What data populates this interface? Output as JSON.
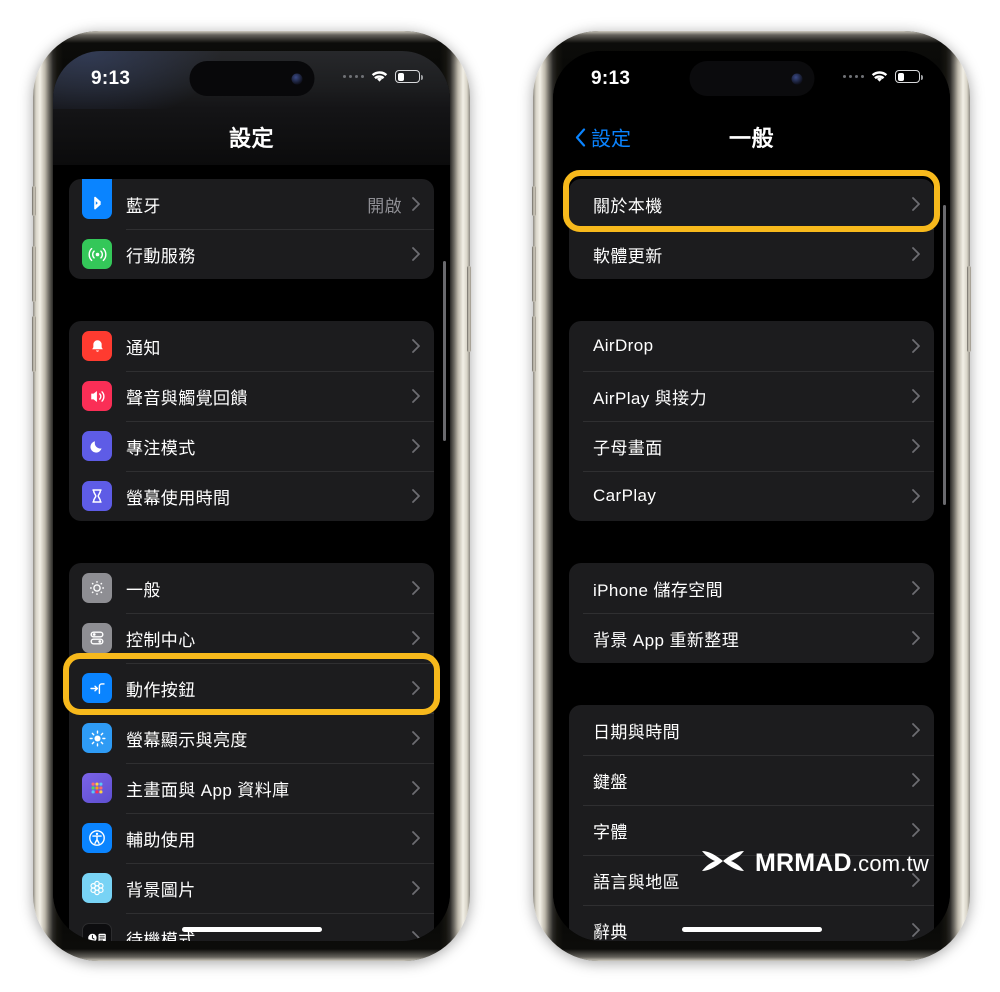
{
  "meta": {
    "highlight_color": "#f7b91c",
    "accent_blue": "#0a84ff",
    "row_bg": "#1c1c1e",
    "screen_bg": "#000000"
  },
  "watermark": {
    "name": "MRMAD",
    "suffix": ".com.tw",
    "logo_icon": "mrmad-bowtie-logo"
  },
  "left_phone": {
    "status_bar": {
      "time": "9:13",
      "cellular_icon": "cellular-dots-icon",
      "wifi_icon": "wifi-icon",
      "battery_icon": "battery-low-icon"
    },
    "nav": {
      "title": "設定"
    },
    "peek_row": {
      "icon": "wifi-app-icon"
    },
    "groups": [
      {
        "rows": [
          {
            "label": "藍牙",
            "value": "開啟",
            "icon": "bluetooth-icon",
            "icon_color": "#0a84ff",
            "chevron": "chevron-right-icon"
          },
          {
            "label": "行動服務",
            "value": "",
            "icon": "cellular-app-icon",
            "icon_color": "#34c759",
            "chevron": "chevron-right-icon"
          }
        ]
      },
      {
        "rows": [
          {
            "label": "通知",
            "value": "",
            "icon": "notifications-icon",
            "icon_color": "#ff3b30",
            "chevron": "chevron-right-icon"
          },
          {
            "label": "聲音與觸覺回饋",
            "value": "",
            "icon": "sounds-haptics-icon",
            "icon_color": "#fa2e56",
            "chevron": "chevron-right-icon"
          },
          {
            "label": "專注模式",
            "value": "",
            "icon": "focus-moon-icon",
            "icon_color": "#5e5ce6",
            "chevron": "chevron-right-icon"
          },
          {
            "label": "螢幕使用時間",
            "value": "",
            "icon": "screen-time-hourglass-icon",
            "icon_color": "#5e5ce6",
            "chevron": "chevron-right-icon"
          }
        ]
      },
      {
        "rows": [
          {
            "label": "一般",
            "value": "",
            "icon": "general-gear-icon",
            "icon_color": "#8e8e93",
            "chevron": "chevron-right-icon",
            "highlighted": true
          },
          {
            "label": "控制中心",
            "value": "",
            "icon": "control-center-icon",
            "icon_color": "#8e8e93",
            "chevron": "chevron-right-icon"
          },
          {
            "label": "動作按鈕",
            "value": "",
            "icon": "action-button-icon",
            "icon_color": "#0a84ff",
            "chevron": "chevron-right-icon"
          },
          {
            "label": "螢幕顯示與亮度",
            "value": "",
            "icon": "display-brightness-icon",
            "icon_color": "#0a84ff",
            "chevron": "chevron-right-icon"
          },
          {
            "label": "主畫面與 App 資料庫",
            "value": "",
            "icon": "home-screen-app-library-icon",
            "icon_color": "#6b5bd6",
            "chevron": "chevron-right-icon"
          },
          {
            "label": "輔助使用",
            "value": "",
            "icon": "accessibility-icon",
            "icon_color": "#0a84ff",
            "chevron": "chevron-right-icon"
          },
          {
            "label": "背景圖片",
            "value": "",
            "icon": "wallpaper-icon",
            "icon_color": "#5ac8f5",
            "chevron": "chevron-right-icon"
          },
          {
            "label": "待機模式",
            "value": "",
            "icon": "standby-icon",
            "icon_color": "#000000",
            "chevron": "chevron-right-icon"
          }
        ]
      }
    ]
  },
  "right_phone": {
    "status_bar": {
      "time": "9:13",
      "cellular_icon": "cellular-dots-icon",
      "wifi_icon": "wifi-icon",
      "battery_icon": "battery-low-icon"
    },
    "nav": {
      "back_label": "設定",
      "back_icon": "chevron-left-icon",
      "title": "一般"
    },
    "groups": [
      {
        "rows": [
          {
            "label": "關於本機",
            "chevron": "chevron-right-icon",
            "highlighted": true
          },
          {
            "label": "軟體更新",
            "chevron": "chevron-right-icon"
          }
        ]
      },
      {
        "rows": [
          {
            "label": "AirDrop",
            "chevron": "chevron-right-icon"
          },
          {
            "label": "AirPlay 與接力",
            "chevron": "chevron-right-icon"
          },
          {
            "label": "子母畫面",
            "chevron": "chevron-right-icon"
          },
          {
            "label": "CarPlay",
            "chevron": "chevron-right-icon"
          }
        ]
      },
      {
        "rows": [
          {
            "label": "iPhone 儲存空間",
            "chevron": "chevron-right-icon"
          },
          {
            "label": "背景 App 重新整理",
            "chevron": "chevron-right-icon"
          }
        ]
      },
      {
        "rows": [
          {
            "label": "日期與時間",
            "chevron": "chevron-right-icon"
          },
          {
            "label": "鍵盤",
            "chevron": "chevron-right-icon"
          },
          {
            "label": "字體",
            "chevron": "chevron-right-icon"
          },
          {
            "label": "語言與地區",
            "chevron": "chevron-right-icon"
          },
          {
            "label": "辭典",
            "chevron": "chevron-right-icon"
          }
        ]
      }
    ]
  }
}
